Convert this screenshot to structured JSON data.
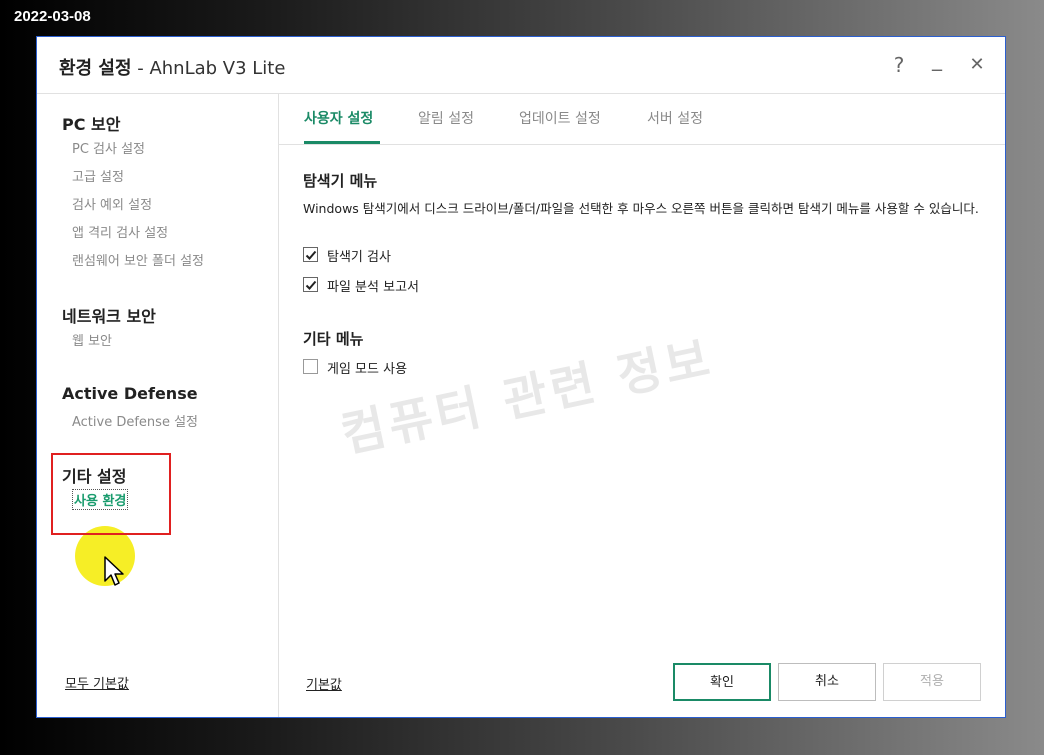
{
  "date_stamp": "2022-03-08",
  "window": {
    "title_bold": "환경 설정",
    "title_rest": " - AhnLab V3 Lite",
    "help": "?",
    "minimize": "_",
    "close": "✕"
  },
  "sidebar": {
    "sections": [
      {
        "title": "PC 보안",
        "items": [
          "PC 검사 설정",
          "고급 설정",
          "검사 예외 설정",
          "앱 격리 검사 설정",
          "랜섬웨어 보안 폴더 설정"
        ]
      },
      {
        "title": "네트워크 보안",
        "items": [
          "웹 보안"
        ]
      },
      {
        "title": "Active Defense",
        "items": [
          "Active Defense 설정"
        ]
      },
      {
        "title": "기타 설정",
        "items": [
          "사용 환경"
        ]
      }
    ],
    "reset_all_label": "모두 기본값"
  },
  "tabs": [
    "사용자 설정",
    "알림 설정",
    "업데이트 설정",
    "서버 설정"
  ],
  "content": {
    "explorer_heading": "탐색기 메뉴",
    "explorer_desc": "Windows 탐색기에서 디스크 드라이브/폴더/파일을 선택한 후 마우스 오른쪽 버튼을 클릭하면 탐색기 메뉴를 사용할 수 있습니다.",
    "explorer_scan_label": "탐색기 검사",
    "explorer_scan_checked": true,
    "file_report_label": "파일 분석 보고서",
    "file_report_checked": true,
    "other_heading": "기타 메뉴",
    "game_mode_label": "게임 모드 사용",
    "game_mode_checked": false,
    "watermark": "컴퓨터 관련 정보"
  },
  "footer": {
    "default_label": "기본값",
    "ok_label": "확인",
    "cancel_label": "취소",
    "apply_label": "적용"
  },
  "colors": {
    "accent": "#1a8a66",
    "highlight_box": "#e02020",
    "cursor_highlight": "#f5eb00"
  }
}
